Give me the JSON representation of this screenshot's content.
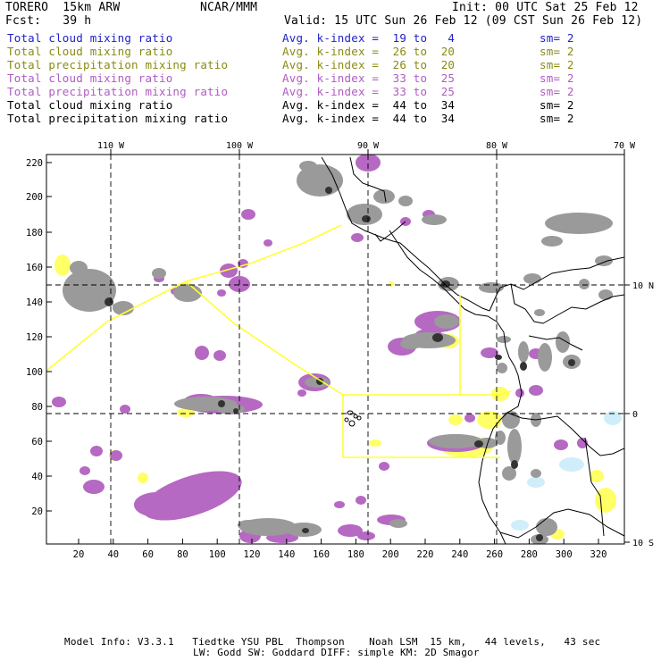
{
  "header": {
    "model": "TORERO  15km ARW",
    "center": "NCAR/MMM",
    "init": "Init: 00 UTC Sat 25 Feb 12",
    "fcst": "Fcst:   39 h",
    "valid": "Valid: 15 UTC Sun 26 Feb 12 (09 CST Sun 26 Feb 12)"
  },
  "legend": [
    {
      "field": "Total cloud mixing ratio",
      "kindex": "Avg. k-index =  19 to   4",
      "sm": "sm= 2",
      "color": "#1f22c8"
    },
    {
      "field": "Total cloud mixing ratio",
      "kindex": "Avg. k-index =  26 to  20",
      "sm": "sm= 2",
      "color": "#8a8a14"
    },
    {
      "field": "Total precipitation mixing ratio",
      "kindex": "Avg. k-index =  26 to  20",
      "sm": "sm= 2",
      "color": "#8a8a14"
    },
    {
      "field": "Total cloud mixing ratio",
      "kindex": "Avg. k-index =  33 to  25",
      "sm": "sm= 2",
      "color": "#b05cc0"
    },
    {
      "field": "Total precipitation mixing ratio",
      "kindex": "Avg. k-index =  33 to  25",
      "sm": "sm= 2",
      "color": "#b05cc0"
    },
    {
      "field": "Total cloud mixing ratio",
      "kindex": "Avg. k-index =  44 to  34",
      "sm": "sm= 2",
      "color": "#000000"
    },
    {
      "field": "Total precipitation mixing ratio",
      "kindex": "Avg. k-index =  44 to  34",
      "sm": "sm= 2",
      "color": "#000000"
    }
  ],
  "map": {
    "lon_labels": [
      "110 W",
      "100 W",
      "90 W",
      "80 W",
      "70 W"
    ],
    "lat_labels": [
      "10 N",
      "0",
      "10 S"
    ],
    "y_ticks": [
      "220",
      "200",
      "180",
      "160",
      "140",
      "120",
      "100",
      "80",
      "60",
      "40",
      "20"
    ],
    "x_ticks": [
      "20",
      "40",
      "60",
      "80",
      "100",
      "120",
      "140",
      "160",
      "180",
      "200",
      "220",
      "240",
      "260",
      "280",
      "300",
      "320"
    ],
    "colors": {
      "border": "#000000",
      "grid": "#000000",
      "route": "#ffff33",
      "cloud_gray": "#9a9a9a",
      "cloud_dark": "#333333",
      "purple": "#b569c2",
      "yellow": "#ffff66",
      "light_blue": "#cfeefa"
    }
  },
  "footer": {
    "line1": "Model Info: V3.3.1   Tiedtke YSU PBL  Thompson    Noah LSM  15 km,   44 levels,   43 sec",
    "line2": "LW: Godd SW: Goddard DIFF: simple KM: 2D Smagor"
  }
}
